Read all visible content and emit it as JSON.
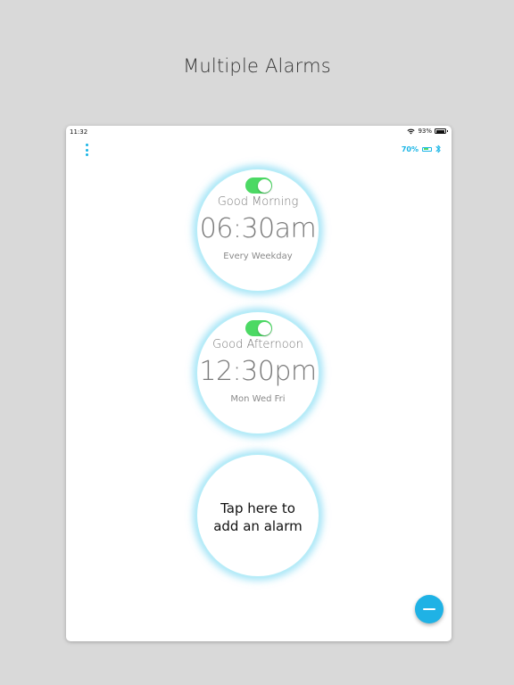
{
  "headline": "Multiple Alarms",
  "status_bar": {
    "time": "11:32",
    "battery_percent": "93%",
    "battery_level": 0.93
  },
  "device_status": {
    "battery_percent": "70%",
    "battery_level": 0.7
  },
  "alarms": [
    {
      "label": "Good Morning",
      "time": "06:30am",
      "days": "Every Weekday",
      "enabled": true
    },
    {
      "label": "Good Afternoon",
      "time": "12:30pm",
      "days": "Mon Wed Fri",
      "enabled": true
    }
  ],
  "add_alarm": {
    "line1": "Tap here to",
    "line2": "add an alarm"
  },
  "colors": {
    "accent": "#19b5e6",
    "toggle_on": "#4cd964",
    "circle_glow": "#60d0f0"
  },
  "icons": {
    "menu": "more-vertical-icon",
    "fab": "minus-icon",
    "bluetooth": "bluetooth-icon",
    "wifi": "wifi-icon",
    "battery": "battery-icon"
  }
}
